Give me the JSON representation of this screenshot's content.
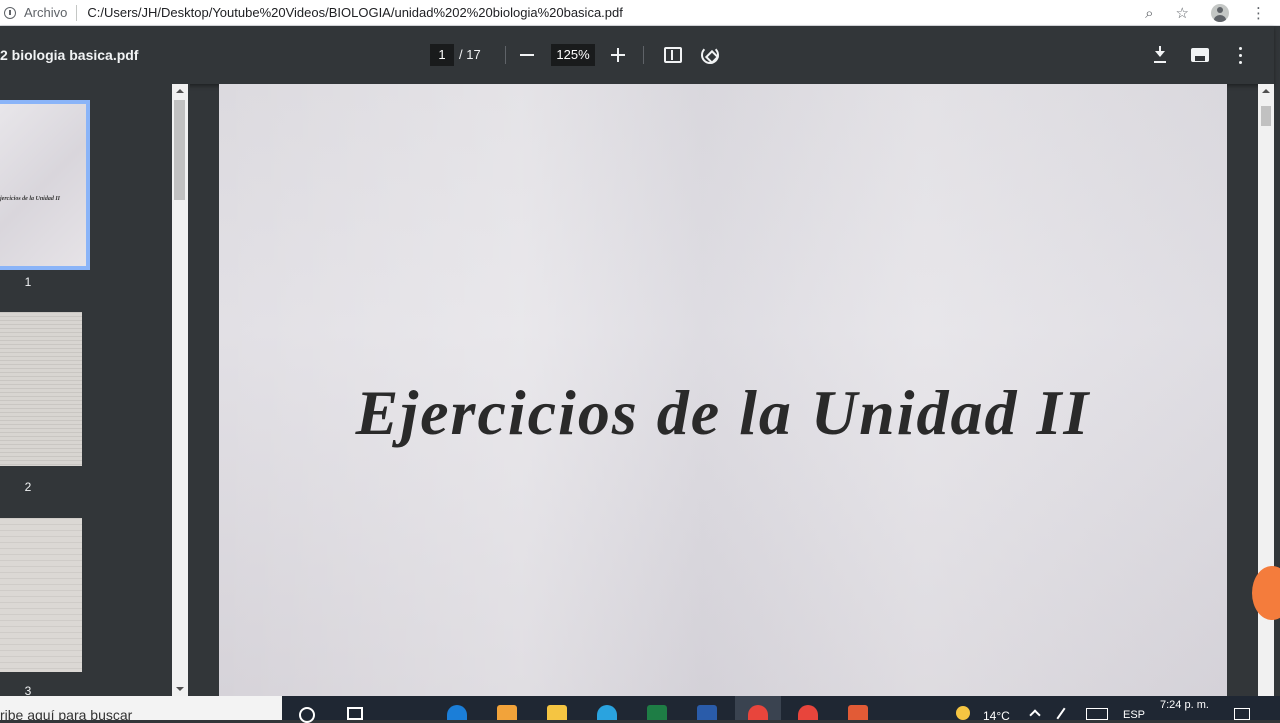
{
  "address_bar": {
    "scheme_label": "Archivo",
    "url": "C:/Users/JH/Desktop/Youtube%20Videos/BIOLOGIA/unidad%202%20biologia%20basica.pdf"
  },
  "pdf_toolbar": {
    "title": "2 biologia basica.pdf",
    "current_page": "1",
    "total_pages": "/ 17",
    "zoom": "125%"
  },
  "thumbnails": [
    {
      "number": "1",
      "caption": "jercicios de la Unidad II",
      "selected": true
    },
    {
      "number": "2",
      "selected": false
    },
    {
      "number": "3",
      "selected": false
    }
  ],
  "document": {
    "heading": "Ejercicios de la Unidad II"
  },
  "taskbar": {
    "search_placeholder": "ribe aquí para buscar",
    "temperature": "14°C",
    "language": "ESP",
    "time": "7:24 p. m."
  },
  "colors": {
    "viewer_bg": "#323639",
    "thumb_selected": "#8ab4f8",
    "taskbar_bg": "#1f2733"
  }
}
